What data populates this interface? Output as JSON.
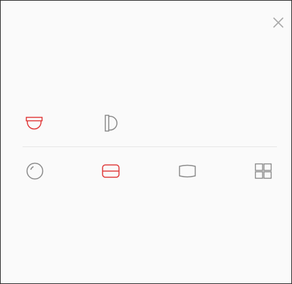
{
  "dialog": {
    "close_icon": "close-icon",
    "mount_modes": [
      {
        "icon": "ceiling-mount-icon",
        "selected": true
      },
      {
        "icon": "wall-mount-icon",
        "selected": false
      }
    ],
    "display_modes": [
      {
        "icon": "fisheye-circle-icon",
        "selected": false
      },
      {
        "icon": "panorama-split-icon",
        "selected": true
      },
      {
        "icon": "panorama-icon",
        "selected": false
      },
      {
        "icon": "quad-view-icon",
        "selected": false
      }
    ]
  },
  "colors": {
    "selected": "#e03a3a",
    "unselected": "#8a8a8a",
    "close": "#a8a8a8"
  }
}
